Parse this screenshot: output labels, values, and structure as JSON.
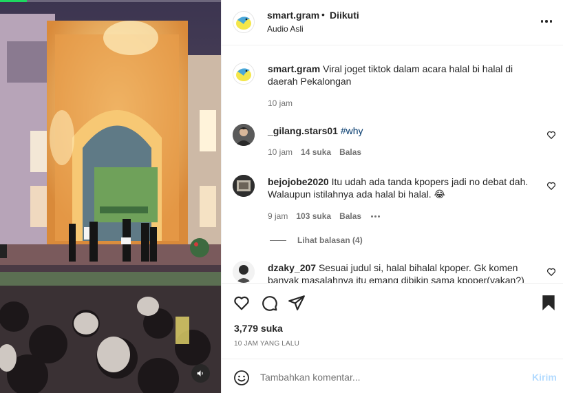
{
  "video": {
    "progress_fraction": 0.12,
    "mute_icon": "speaker-icon",
    "colors": {
      "progress": "#1ed760"
    }
  },
  "header": {
    "username": "smart.gram",
    "separator": "•",
    "follow_status": "Diikuti",
    "audio": "Audio Asli",
    "more_icon": "more-horizontal-icon"
  },
  "caption": {
    "username": "smart.gram",
    "text": "Viral joget tiktok dalam acara halal bi halal di daerah Pekalongan",
    "time": "10 jam"
  },
  "comments": [
    {
      "username": "_gilang.stars01",
      "text": "#why",
      "time": "10 jam",
      "likes": "14 suka",
      "reply": "Balas"
    },
    {
      "username": "bejojobe2020",
      "text": "Itu udah ada tanda kpopers jadi no debat dah. Walaupun istilahnya ada halal bi halal. 😂",
      "time": "9 jam",
      "likes": "103 suka",
      "reply": "Balas",
      "view_replies": "Lihat balasan (4)"
    },
    {
      "username": "dzaky_207",
      "text": "Sesuai judul si, halal bihalal kpoper. Gk komen banyak masalahnya itu emang dibikin sama kpoper(yakan?)"
    }
  ],
  "actions": {
    "like_icon": "heart-icon",
    "comment_icon": "comment-icon",
    "share_icon": "share-icon",
    "save_icon": "bookmark-icon",
    "likes": "3,779 suka",
    "time_ago": "10 JAM YANG LALU"
  },
  "add_comment": {
    "placeholder": "Tambahkan komentar...",
    "post_label": "Kirim",
    "emoji_icon": "emoji-icon"
  }
}
